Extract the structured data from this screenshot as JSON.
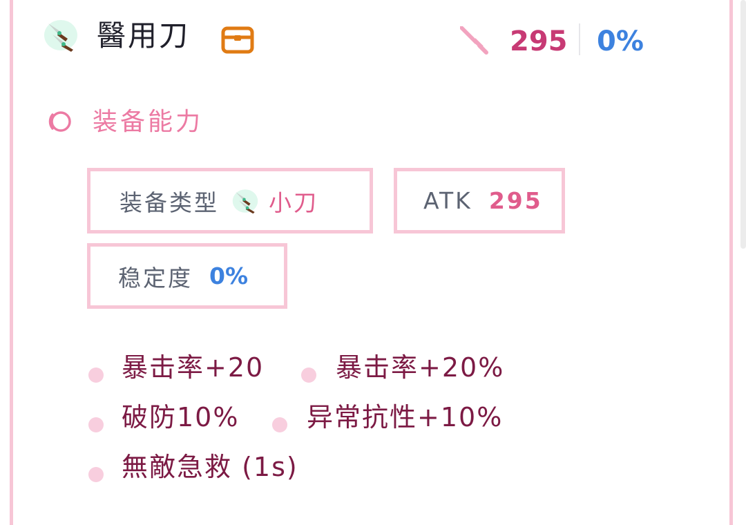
{
  "item": {
    "name": "醫用刀",
    "icon": "twin-knife-icon",
    "chest_icon": "chest-icon"
  },
  "summary": {
    "atk_icon": "sword-icon",
    "atk_value": "295",
    "stability_value": "0%"
  },
  "section": {
    "icon": "swirl-icon",
    "title": "装备能力"
  },
  "properties": {
    "equip_type_label": "装备类型",
    "equip_type_value": "小刀",
    "atk_label": "ATK",
    "atk_value": "295",
    "stability_label": "稳定度",
    "stability_value": "0%"
  },
  "abilities": [
    "暴击率+20",
    "暴击率+20%",
    "破防10%",
    "异常抗性+10%",
    "無敵急救 (1s)"
  ],
  "colors": {
    "accent_pink": "#f7c6d6",
    "atk_pink": "#c73a74",
    "stability_blue": "#3d82df",
    "ability_text": "#7c1a44"
  }
}
